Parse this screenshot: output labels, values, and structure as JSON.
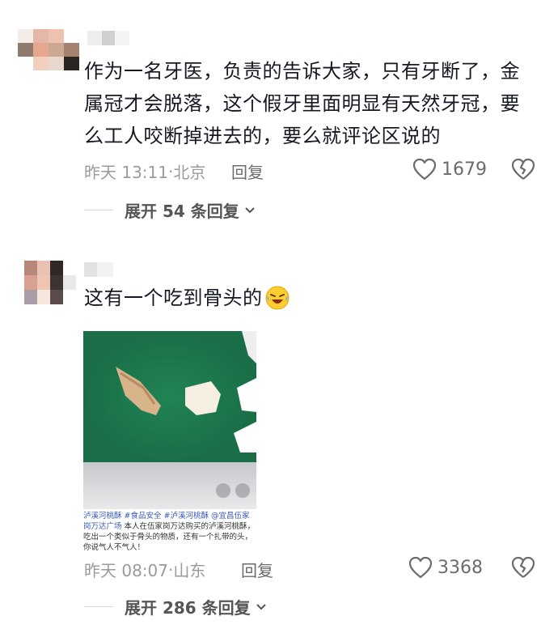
{
  "comments": [
    {
      "text": "作为一名牙医，负责的告诉大家，只有牙断了，金属冠才会脱落，这个假牙里面明显有天然牙冠，要么工人咬断掉进去的，要么就评论区说的",
      "lines": [
        "作为一名牙医，负责的告诉大家，只有牙断了，金",
        "属冠才会脱落，这个假牙里面明显有天然牙冠，要",
        "么工人咬断掉进去的，要么就评论区说的"
      ],
      "time": "昨天 13:11",
      "location": "北京",
      "reply_label": "回复",
      "likes": "1679",
      "expand": "展开 54 条回复"
    },
    {
      "text": "这有一个吃到骨头的",
      "emoji": "laughing-crying-emoji",
      "media": {
        "caption_tags": "泸溪河桃酥 #食品安全 #泸溪河桃酥 @宜昌伍家岗万达广场",
        "caption_body": "本人在伍家岗万达购买的泸溪河桃酥，吃出一个类似于骨头的物质，还有一个扎带的头，你说气人不气人！"
      },
      "time": "昨天 08:07",
      "location": "山东",
      "reply_label": "回复",
      "likes": "3368",
      "expand": "展开 286 条回复"
    }
  ],
  "icons": {
    "like": "heart-outline-icon",
    "dislike": "broken-heart-icon",
    "expand": "chevron-down-icon"
  }
}
